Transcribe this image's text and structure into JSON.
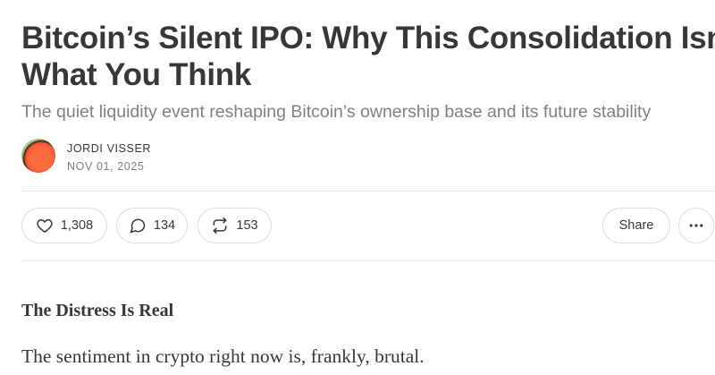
{
  "post": {
    "title_line1": "Bitcoin’s Silent IPO: Why This Consolidation Isn’t",
    "title_line2": "What You Think",
    "subtitle": "The quiet liquidity event reshaping Bitcoin’s ownership base and its future stability"
  },
  "author": {
    "name": "JORDI VISSER",
    "date": "NOV 01, 2025"
  },
  "actions": {
    "likes": "1,308",
    "comments": "134",
    "restacks": "153",
    "share_label": "Share",
    "like_icon": "heart-icon",
    "comment_icon": "comment-icon",
    "restack_icon": "restack-icon",
    "more_icon": "more-icon"
  },
  "body": {
    "section_heading": "The Distress Is Real",
    "paragraph": "The sentiment in crypto right now is, frankly, brutal."
  },
  "colors": {
    "text": "#363737",
    "muted": "#808080",
    "border": "#dcdcdc"
  }
}
